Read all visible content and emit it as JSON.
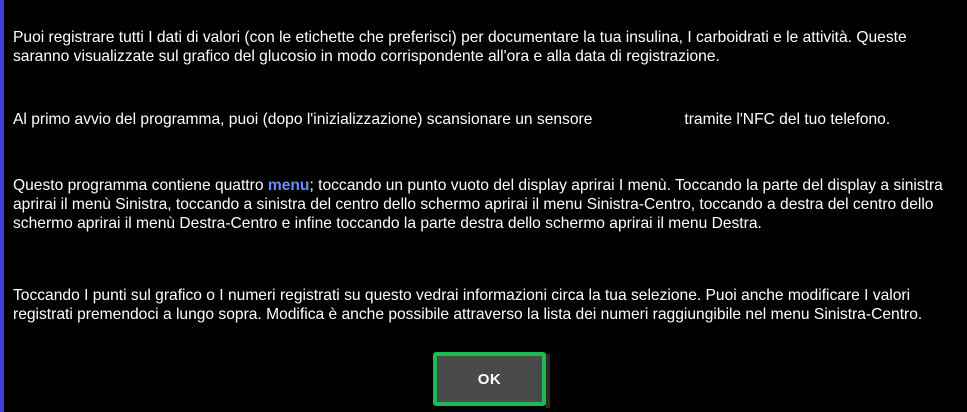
{
  "dialog": {
    "paragraphs": {
      "p1": "Puoi registrare tutti I dati di valori (con le etichette che preferisci) per documentare la tua insulina, I carboidrati e le attività. Queste saranno visualizzate sul grafico del glucosio in modo corrispondente all'ora e alla data di registrazione.",
      "p2_before": "Al primo avvio del programma, puoi (dopo l'inizializzazione) scansionare un sensore",
      "p2_after": "tramite l'NFC del tuo telefono.",
      "p3_before": "Questo programma contiene quattro",
      "p3_link": "menu",
      "p3_after": "; toccando un punto vuoto del display aprirai I menù. Toccando la parte del display a sinistra aprirai il menù Sinistra, toccando a sinistra del centro dello schermo aprirai il menu Sinistra-Centro, toccando a destra del centro dello schermo aprirai il menù Destra-Centro e infine toccando la parte destra dello schermo aprirai il menu Destra.",
      "p4": "Toccando I punti sul grafico o I numeri registrati su questo vedrai informazioni circa la tua selezione. Puoi anche modificare I valori registrati premendoci a lungo sopra. Modifica è anche possibile attraverso la lista dei numeri raggiungibile nel menu Sinistra-Centro."
    },
    "ok_label": "OK"
  },
  "colors": {
    "background": "#000000",
    "text": "#ffffff",
    "link": "#6b8cff",
    "button_bg": "#4a4a4a",
    "button_border": "#1db954",
    "left_edge": "#3f3fd9"
  }
}
